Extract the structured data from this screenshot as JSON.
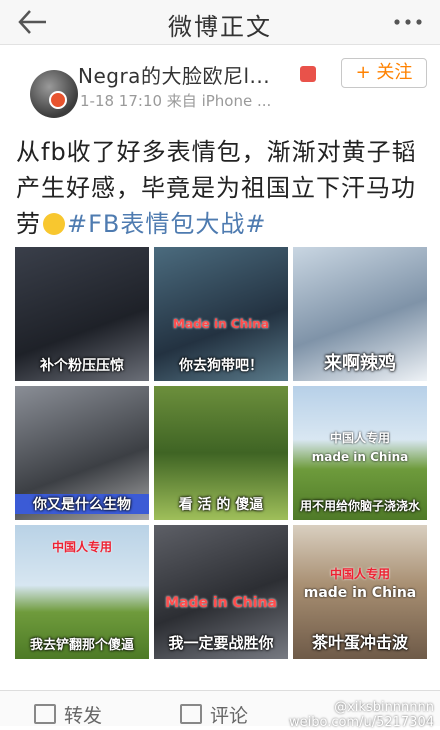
{
  "nav": {
    "title": "微博正文"
  },
  "post": {
    "author": "Negra的大脸欧尼l...",
    "meta": "1-18 17:10 来自 iPhone ...",
    "follow_label": "+ 关注",
    "text_a": "从fb收了好多表情包，渐渐对黄子韬产生好感，毕竟是为祖国立下汗马功劳",
    "topic": "#FB表情包大战#"
  },
  "images": [
    {
      "caption": "补个粉压压惊"
    },
    {
      "caption": "你去狗带吧！",
      "stamp": "Made in China"
    },
    {
      "caption": "来啊辣鸡"
    },
    {
      "caption": "你又是什么生物"
    },
    {
      "caption": "看 活 的 傻逼"
    },
    {
      "caption": "用不用给你脑子浇浇水",
      "stamp": "中国人专用",
      "stamp2": "made in China"
    },
    {
      "caption": "我去铲翻那个傻逼",
      "stamp": "中国人专用"
    },
    {
      "caption": "我一定要战胜你",
      "stamp": "Made in China"
    },
    {
      "caption": "茶叶蛋冲击波",
      "stamp": "made in China",
      "stamp2": "中国人专用"
    }
  ],
  "footer": {
    "repost": "转发",
    "comment": "评论"
  },
  "watermark": {
    "line1": "@xiksbinnnnnn",
    "line2": "weibo.com/u/5217304"
  },
  "colors": {
    "topic": "#4e7bb0",
    "follow": "#ff8200"
  }
}
